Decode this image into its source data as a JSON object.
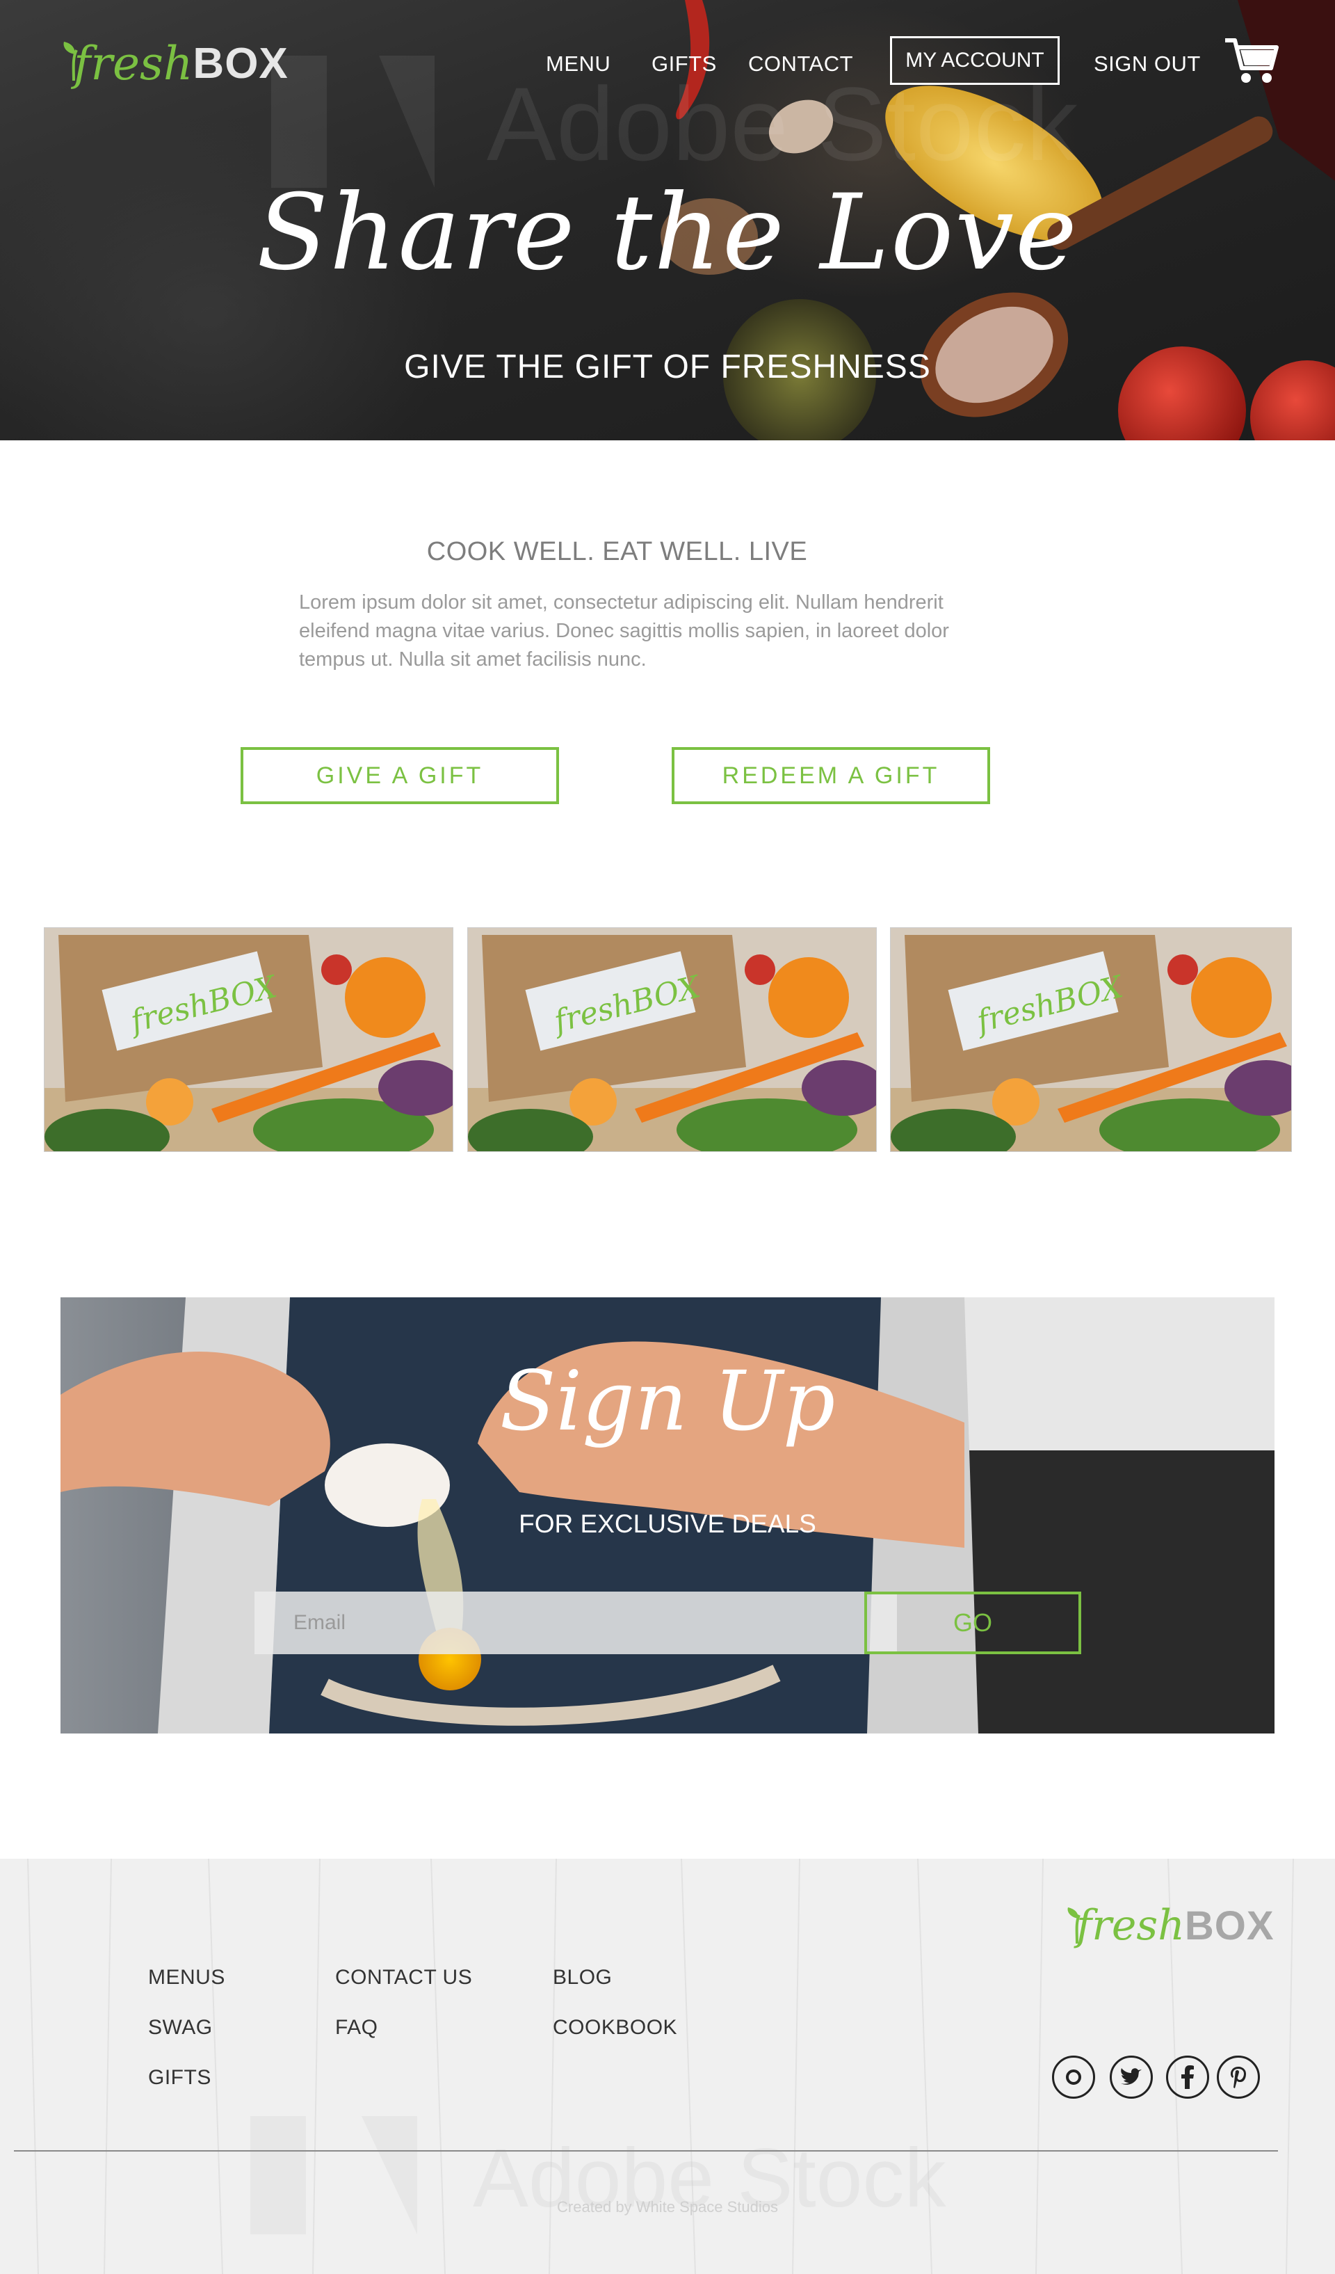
{
  "brand": {
    "logo_fresh": "fresh",
    "logo_box": "BOX",
    "accent": "#7bc142"
  },
  "nav": {
    "items": [
      "MENU",
      "GIFTS",
      "CONTACT"
    ],
    "account": "MY ACCOUNT",
    "signout": "SIGN OUT",
    "cart_icon": "cart-icon"
  },
  "hero": {
    "script": "Share the Love",
    "subtitle": "GIVE THE GIFT OF FRESHNESS",
    "watermark": "Adobe Stock"
  },
  "intro": {
    "title": "COOK WELL. EAT WELL. LIVE",
    "body": "Lorem ipsum dolor sit amet, consectetur adipiscing elit. Nullam hendrerit eleifend magna vitae varius. Donec sagittis mollis sapien, in laoreet dolor tempus ut. Nulla sit amet facilisis nunc."
  },
  "cta": {
    "give": "GIVE A GIFT",
    "redeem": "REDEEM A GIFT"
  },
  "photos": [
    {
      "box_label": "freshBOX"
    },
    {
      "box_label": "freshBOX"
    },
    {
      "box_label": "freshBOX"
    }
  ],
  "signup": {
    "script": "Sign Up",
    "subtitle": "FOR EXCLUSIVE DEALS",
    "email_placeholder": "Email",
    "go": "GO"
  },
  "footer": {
    "col1": [
      "MENUS",
      "SWAG",
      "GIFTS"
    ],
    "col2": [
      "CONTACT US",
      "FAQ"
    ],
    "col3": [
      "BLOG",
      "COOKBOOK"
    ],
    "social": [
      "instagram-icon",
      "twitter-icon",
      "facebook-icon",
      "pinterest-icon"
    ],
    "credit": "Created by White Space Studios",
    "watermark": "Adobe Stock"
  }
}
